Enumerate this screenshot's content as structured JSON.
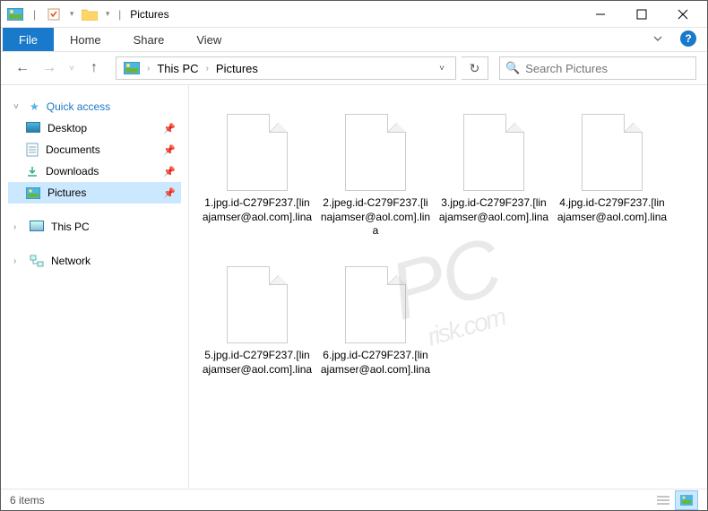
{
  "window": {
    "title": "Pictures",
    "separator": "|"
  },
  "tabs": {
    "file": "File",
    "home": "Home",
    "share": "Share",
    "view": "View"
  },
  "nav": {
    "path": [
      "This PC",
      "Pictures"
    ]
  },
  "search": {
    "placeholder": "Search Pictures"
  },
  "sidebar": {
    "quick_access": "Quick access",
    "items": [
      {
        "label": "Desktop",
        "icon": "desktop"
      },
      {
        "label": "Documents",
        "icon": "documents"
      },
      {
        "label": "Downloads",
        "icon": "downloads"
      },
      {
        "label": "Pictures",
        "icon": "pictures",
        "selected": true
      }
    ],
    "this_pc": "This PC",
    "network": "Network"
  },
  "files": [
    {
      "name": "1.jpg.id-C279F237.[linajamser@aol.com].lina"
    },
    {
      "name": "2.jpeg.id-C279F237.[linajamser@aol.com].lina"
    },
    {
      "name": "3.jpg.id-C279F237.[linajamser@aol.com].lina"
    },
    {
      "name": "4.jpg.id-C279F237.[linajamser@aol.com].lina"
    },
    {
      "name": "5.jpg.id-C279F237.[linajamser@aol.com].lina"
    },
    {
      "name": "6.jpg.id-C279F237.[linajamser@aol.com].lina"
    }
  ],
  "status": {
    "count_text": "6 items"
  },
  "watermark": {
    "big": "PC",
    "small": "risk.com"
  }
}
